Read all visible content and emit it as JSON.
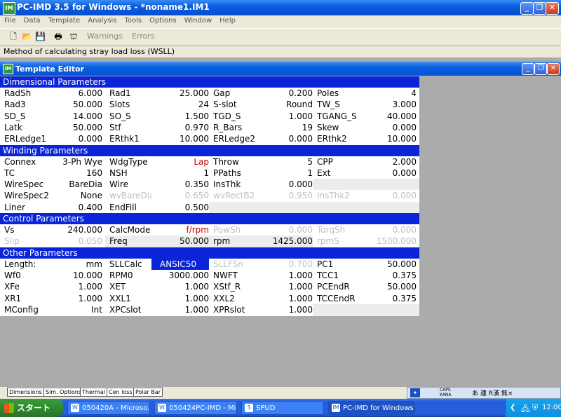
{
  "app": {
    "title": "PC-IMD 3.5 for Windows - *noname1.IM1",
    "icon": "IM"
  },
  "menu": [
    "File",
    "Data",
    "Template",
    "Analysis",
    "Tools",
    "Options",
    "Window",
    "Help"
  ],
  "toolbar": {
    "warnings": "Warnings",
    "errors": "Errors"
  },
  "status_line": "Method of calculating stray load loss (WSLL)",
  "editor": {
    "title": "Template Editor",
    "sections": [
      {
        "title": "Dimensional Parameters",
        "rows": [
          [
            [
              "RadSh",
              "6.000"
            ],
            [
              "Rad1",
              "25.000"
            ],
            [
              "Gap",
              "0.200"
            ],
            [
              "Poles",
              "4"
            ]
          ],
          [
            [
              "Rad3",
              "50.000"
            ],
            [
              "Slots",
              "24"
            ],
            [
              "S-slot",
              "Round"
            ],
            [
              "TW_S",
              "3.000"
            ]
          ],
          [
            [
              "SD_S",
              "14.000"
            ],
            [
              "SO_S",
              "1.500"
            ],
            [
              "TGD_S",
              "1.000"
            ],
            [
              "TGANG_S",
              "40.000"
            ]
          ],
          [
            [
              "Latk",
              "50.000"
            ],
            [
              "Stf",
              "0.970"
            ],
            [
              "R_Bars",
              "19"
            ],
            [
              "Skew",
              "0.000"
            ]
          ],
          [
            [
              "ERLedge1",
              "0.000"
            ],
            [
              "ERthk1",
              "10.000"
            ],
            [
              "ERLedge2",
              "0.000"
            ],
            [
              "ERthk2",
              "10.000"
            ]
          ]
        ]
      },
      {
        "title": "Winding Parameters",
        "rows": [
          [
            [
              "Connex",
              "3-Ph Wye"
            ],
            [
              "WdgType",
              "Lap"
            ],
            [
              "Throw",
              "5"
            ],
            [
              "CPP",
              "2.000"
            ]
          ],
          [
            [
              "TC",
              "160"
            ],
            [
              "NSH",
              "1"
            ],
            [
              "PPaths",
              "1"
            ],
            [
              "Ext",
              "0.000"
            ]
          ],
          [
            [
              "WireSpec",
              "BareDia"
            ],
            [
              "Wire",
              "0.350"
            ],
            [
              "InsThk",
              "0.000"
            ],
            [
              "",
              ""
            ]
          ],
          [
            [
              "WireSpec2",
              "None"
            ],
            [
              "wvBareDia",
              "0.650"
            ],
            [
              "wvRectB2",
              "0.950"
            ],
            [
              "InsThk2",
              "0.000"
            ]
          ],
          [
            [
              "Liner",
              "0.400"
            ],
            [
              "EndFill",
              "0.500"
            ],
            [
              "",
              ""
            ],
            [
              "",
              ""
            ]
          ]
        ]
      },
      {
        "title": "Control Parameters",
        "rows": [
          [
            [
              "Vs",
              "240.000"
            ],
            [
              "CalcMode",
              "f/rpm"
            ],
            [
              "PowSh",
              "0.000"
            ],
            [
              "TorqSh",
              "0.000"
            ]
          ],
          [
            [
              "Slip",
              "0.050"
            ],
            [
              "Freq",
              "50.000"
            ],
            [
              "rpm",
              "1425.000"
            ],
            [
              "rpmS",
              "1500.000"
            ]
          ]
        ]
      },
      {
        "title": "Other Parameters",
        "rows": [
          [
            [
              "Length:",
              "mm"
            ],
            [
              "SLLCalc",
              "ANSIC50"
            ],
            [
              "SLLFSn",
              "0.700"
            ],
            [
              "PC1",
              "50.000"
            ]
          ],
          [
            [
              "Wf0",
              "10.000"
            ],
            [
              "RPM0",
              "3000.000"
            ],
            [
              "NWFT",
              "1.000"
            ],
            [
              "TCC1",
              "0.375"
            ]
          ],
          [
            [
              "XFe",
              "1.000"
            ],
            [
              "XET",
              "1.000"
            ],
            [
              "XStf_R",
              "1.000"
            ],
            [
              "PCEndR",
              "50.000"
            ]
          ],
          [
            [
              "XR1",
              "1.000"
            ],
            [
              "XXL1",
              "1.000"
            ],
            [
              "XXL2",
              "1.000"
            ],
            [
              "TCCEndR",
              "0.375"
            ]
          ],
          [
            [
              "MConfig",
              "Int"
            ],
            [
              "XPCslot",
              "1.000"
            ],
            [
              "XPRslot",
              "1.000"
            ],
            [
              "",
              ""
            ]
          ]
        ]
      }
    ]
  },
  "bottom_tabs": [
    "Dimensions",
    "Sim. Options",
    "Thermal",
    "Cen loss",
    "Polar Bar"
  ],
  "ime": {
    "caps": "CAPS",
    "kana": "KANA",
    "chars": "あ 連 R漢 無×"
  },
  "taskbar": {
    "start": "スタート",
    "tasks": [
      "050420A - Microso...",
      "050424PC-IMD - Mic...",
      "SPUD",
      "PC-IMD for Windows"
    ],
    "clock": "12:00"
  }
}
